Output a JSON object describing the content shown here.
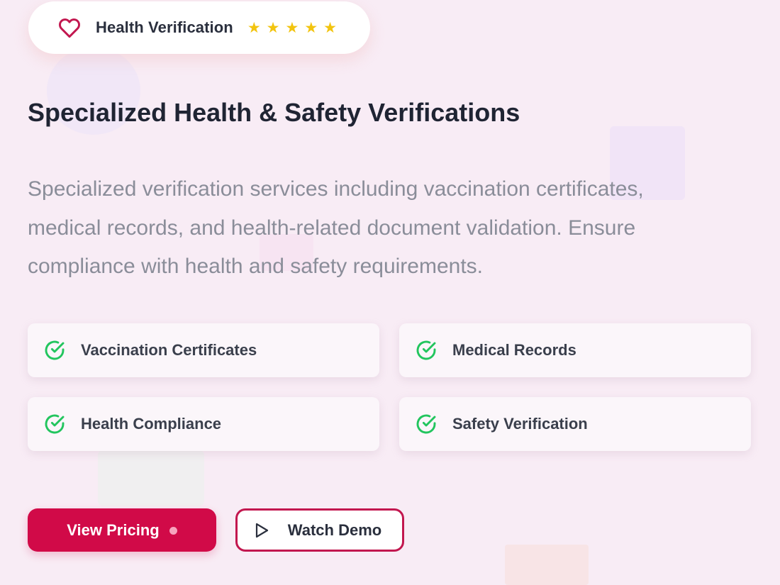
{
  "badge": {
    "icon": "heart-icon",
    "label": "Health Verification",
    "rating": 5,
    "star_icon": "star-icon"
  },
  "section": {
    "title": "Specialized Health & Safety Verifications",
    "description": "Specialized verification services including vaccination certificates, medical records, and health-related document validation. Ensure compliance with health and safety requirements."
  },
  "features": [
    {
      "label": "Vaccination Certificates",
      "icon": "check-circle-icon"
    },
    {
      "label": "Medical Records",
      "icon": "check-circle-icon"
    },
    {
      "label": "Health Compliance",
      "icon": "check-circle-icon"
    },
    {
      "label": "Safety Verification",
      "icon": "check-circle-icon"
    }
  ],
  "actions": {
    "primary_label": "View Pricing",
    "secondary_label": "Watch Demo",
    "secondary_icon": "play-icon"
  },
  "colors": {
    "accent": "#d10a48",
    "check": "#22c55e",
    "star": "#f2c40f",
    "heart": "#c2174f",
    "background": "#f8ecf5"
  }
}
